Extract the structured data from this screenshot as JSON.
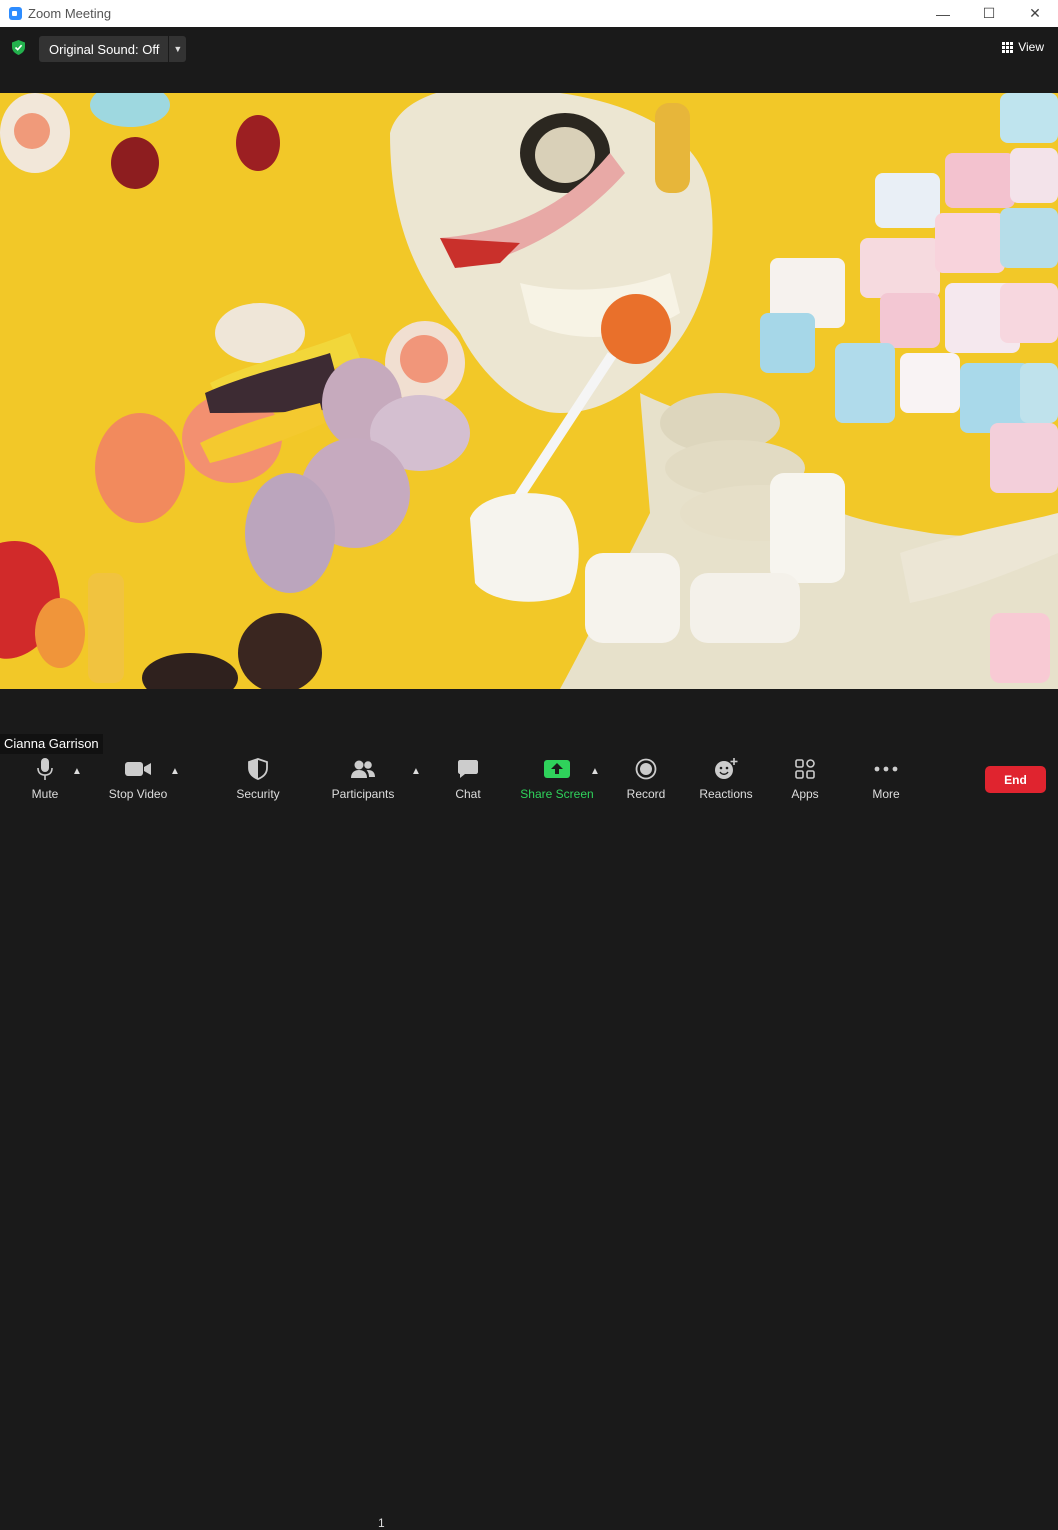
{
  "window": {
    "title": "Zoom Meeting",
    "controls": {
      "minimize": "—",
      "maximize": "☐",
      "close": "✕"
    }
  },
  "topbar": {
    "original_sound": "Original Sound: Off",
    "view_label": "View"
  },
  "participant": {
    "name": "Cianna Garrison"
  },
  "toolbar": {
    "mute": "Mute",
    "stop_video": "Stop Video",
    "security": "Security",
    "participants": "Participants",
    "participants_count": "1",
    "chat": "Chat",
    "share_screen": "Share Screen",
    "record": "Record",
    "reactions": "Reactions",
    "apps": "Apps",
    "more": "More",
    "end": "End"
  },
  "colors": {
    "accent": "#2d8cff",
    "share": "#2fd25b",
    "end": "#e0242f",
    "background": "#1a1a1a",
    "video_bg": "#f2c828"
  }
}
